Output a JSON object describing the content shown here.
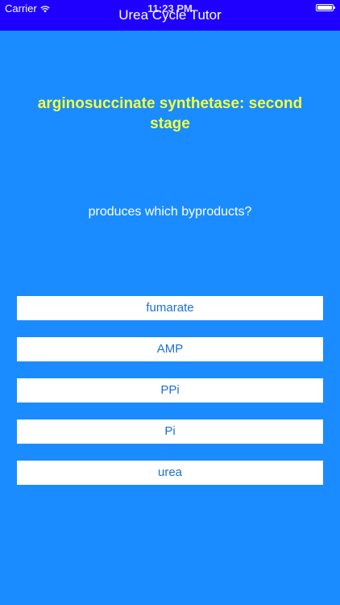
{
  "status_bar": {
    "carrier": "Carrier",
    "time": "11:23 PM",
    "wifi_icon": "wifi-icon",
    "battery_icon": "battery-icon"
  },
  "nav": {
    "title": "Urea Cycle Tutor"
  },
  "quiz": {
    "topic": "arginosuccinate synthetase: second stage",
    "question": "produces which byproducts?",
    "answers": [
      {
        "label": "fumarate"
      },
      {
        "label": "AMP"
      },
      {
        "label": "PPi"
      },
      {
        "label": "Pi"
      },
      {
        "label": "urea"
      }
    ]
  },
  "colors": {
    "background": "#1a8cff",
    "nav_bar": "#1f00ff",
    "topic_text": "#f5ff3c",
    "button_text": "#1b6fd6"
  }
}
